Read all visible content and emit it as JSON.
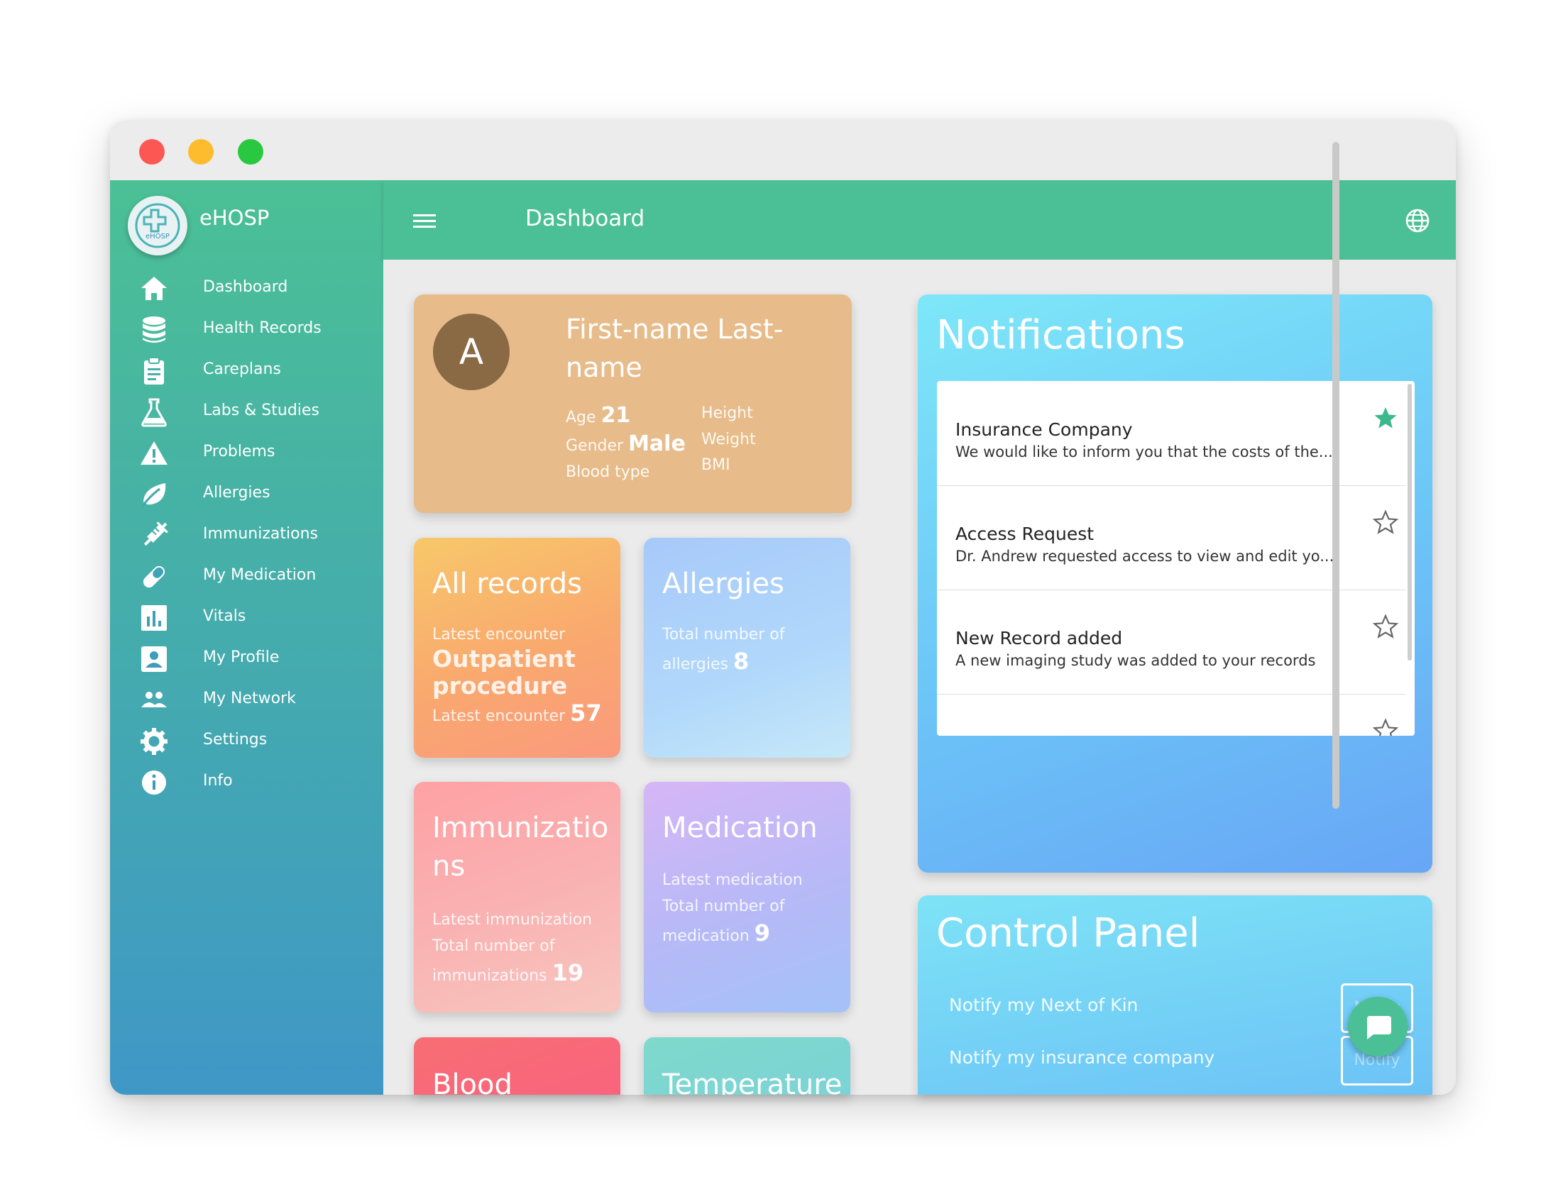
{
  "app": {
    "name": "eHOSP",
    "logo_text": "eHOSP"
  },
  "header": {
    "title": "Dashboard",
    "icons": [
      "menu-icon",
      "globe-icon",
      "refresh-icon",
      "logout-icon"
    ]
  },
  "sidebar": {
    "items": [
      {
        "label": "Dashboard",
        "icon": "home-icon"
      },
      {
        "label": "Health Records",
        "icon": "database-icon"
      },
      {
        "label": "Careplans",
        "icon": "clipboard-icon"
      },
      {
        "label": "Labs & Studies",
        "icon": "flask-icon"
      },
      {
        "label": "Problems",
        "icon": "warning-icon"
      },
      {
        "label": "Allergies",
        "icon": "leaf-icon"
      },
      {
        "label": "Immunizations",
        "icon": "syringe-icon"
      },
      {
        "label": "My Medication",
        "icon": "pill-icon"
      },
      {
        "label": "Vitals",
        "icon": "chart-icon"
      },
      {
        "label": "My Profile",
        "icon": "profile-icon"
      },
      {
        "label": "My Network",
        "icon": "people-icon"
      },
      {
        "label": "Settings",
        "icon": "gear-icon"
      },
      {
        "label": "Info",
        "icon": "info-icon"
      }
    ]
  },
  "patient": {
    "initial": "A",
    "name": "First-name Last-name",
    "age_label": "Age",
    "age": "21",
    "gender_label": "Gender",
    "gender": "Male",
    "blood_label": "Blood type",
    "height_label": "Height",
    "weight_label": "Weight",
    "bmi_label": "BMI"
  },
  "cards": {
    "all_records": {
      "title": "All records",
      "encounter_label": "Latest encounter",
      "encounter_value": "Outpatient procedure",
      "count_label": "Latest encounter",
      "count": "57"
    },
    "allergies": {
      "title": "Allergies",
      "label_1": "Total number of",
      "label_2": "allergies",
      "count": "8"
    },
    "immunizations": {
      "title_1": "Immunizatio",
      "title_2": "ns",
      "label_1": "Latest immunization",
      "label_2": "Total number of",
      "label_3": "immunizations",
      "count": "19"
    },
    "medication": {
      "title": "Medication",
      "label_1": "Latest medication",
      "label_2": "Total number of",
      "label_3": "medication",
      "count": "9"
    },
    "blood": {
      "title": "Blood"
    },
    "temperature": {
      "title": "Temperature"
    }
  },
  "notifications": {
    "title": "Notifications",
    "items": [
      {
        "title": "Insurance Company",
        "body": "We would like to inform you that the costs of the...",
        "starred": true
      },
      {
        "title": "Access Request",
        "body": "Dr. Andrew requested access to view and edit yo...",
        "starred": false
      },
      {
        "title": "New Record added",
        "body": "A new imaging study was added to your records",
        "starred": false
      }
    ]
  },
  "control_panel": {
    "title": "Control Panel",
    "rows": [
      {
        "label": "Notify my Next of Kin",
        "button": "Notify"
      },
      {
        "label": "Notify my insurance company",
        "button": "Notify"
      }
    ]
  },
  "colors": {
    "primary": "#4bbf95",
    "star_active": "#3cb98c"
  }
}
